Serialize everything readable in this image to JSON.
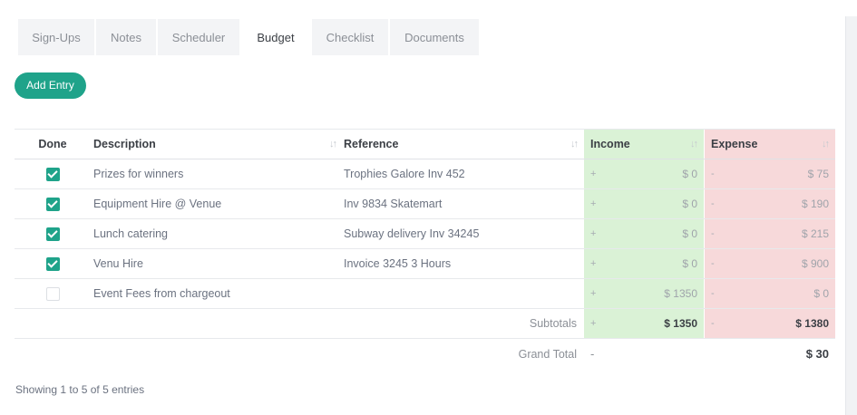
{
  "tabs": [
    {
      "label": "Sign-Ups",
      "active": false
    },
    {
      "label": "Notes",
      "active": false
    },
    {
      "label": "Scheduler",
      "active": false
    },
    {
      "label": "Budget",
      "active": true
    },
    {
      "label": "Checklist",
      "active": false
    },
    {
      "label": "Documents",
      "active": false
    }
  ],
  "add_button": "Add Entry",
  "table": {
    "headers": {
      "done": "Done",
      "description": "Description",
      "reference": "Reference",
      "income": "Income",
      "expense": "Expense"
    },
    "sort_icon": "sort-icon",
    "rows": [
      {
        "done": true,
        "description": "Prizes for winners",
        "reference": "Trophies Galore Inv 452",
        "income_sign": "+",
        "income": "$ 0",
        "expense_sign": "-",
        "expense": "$ 75"
      },
      {
        "done": true,
        "description": "Equipment Hire @ Venue",
        "reference": "Inv 9834 Skatemart",
        "income_sign": "+",
        "income": "$ 0",
        "expense_sign": "-",
        "expense": "$ 190"
      },
      {
        "done": true,
        "description": "Lunch catering",
        "reference": "Subway delivery Inv 34245",
        "income_sign": "+",
        "income": "$ 0",
        "expense_sign": "-",
        "expense": "$ 215"
      },
      {
        "done": true,
        "description": "Venu Hire",
        "reference": "Invoice 3245 3 Hours",
        "income_sign": "+",
        "income": "$ 0",
        "expense_sign": "-",
        "expense": "$ 900"
      },
      {
        "done": false,
        "description": "Event Fees from chargeout",
        "reference": "",
        "income_sign": "+",
        "income": "$ 1350",
        "expense_sign": "-",
        "expense": "$ 0"
      }
    ],
    "subtotals": {
      "label": "Subtotals",
      "income_sign": "+",
      "income": "$ 1350",
      "expense_sign": "-",
      "expense": "$ 1380"
    },
    "grand_total": {
      "label": "Grand Total",
      "sign": "-",
      "amount": "$ 30"
    }
  },
  "footer": "Showing 1 to 5 of 5 entries",
  "colors": {
    "accent": "#1fa38a",
    "income_bg": "#daf2d6",
    "expense_bg": "#f7d9da"
  }
}
